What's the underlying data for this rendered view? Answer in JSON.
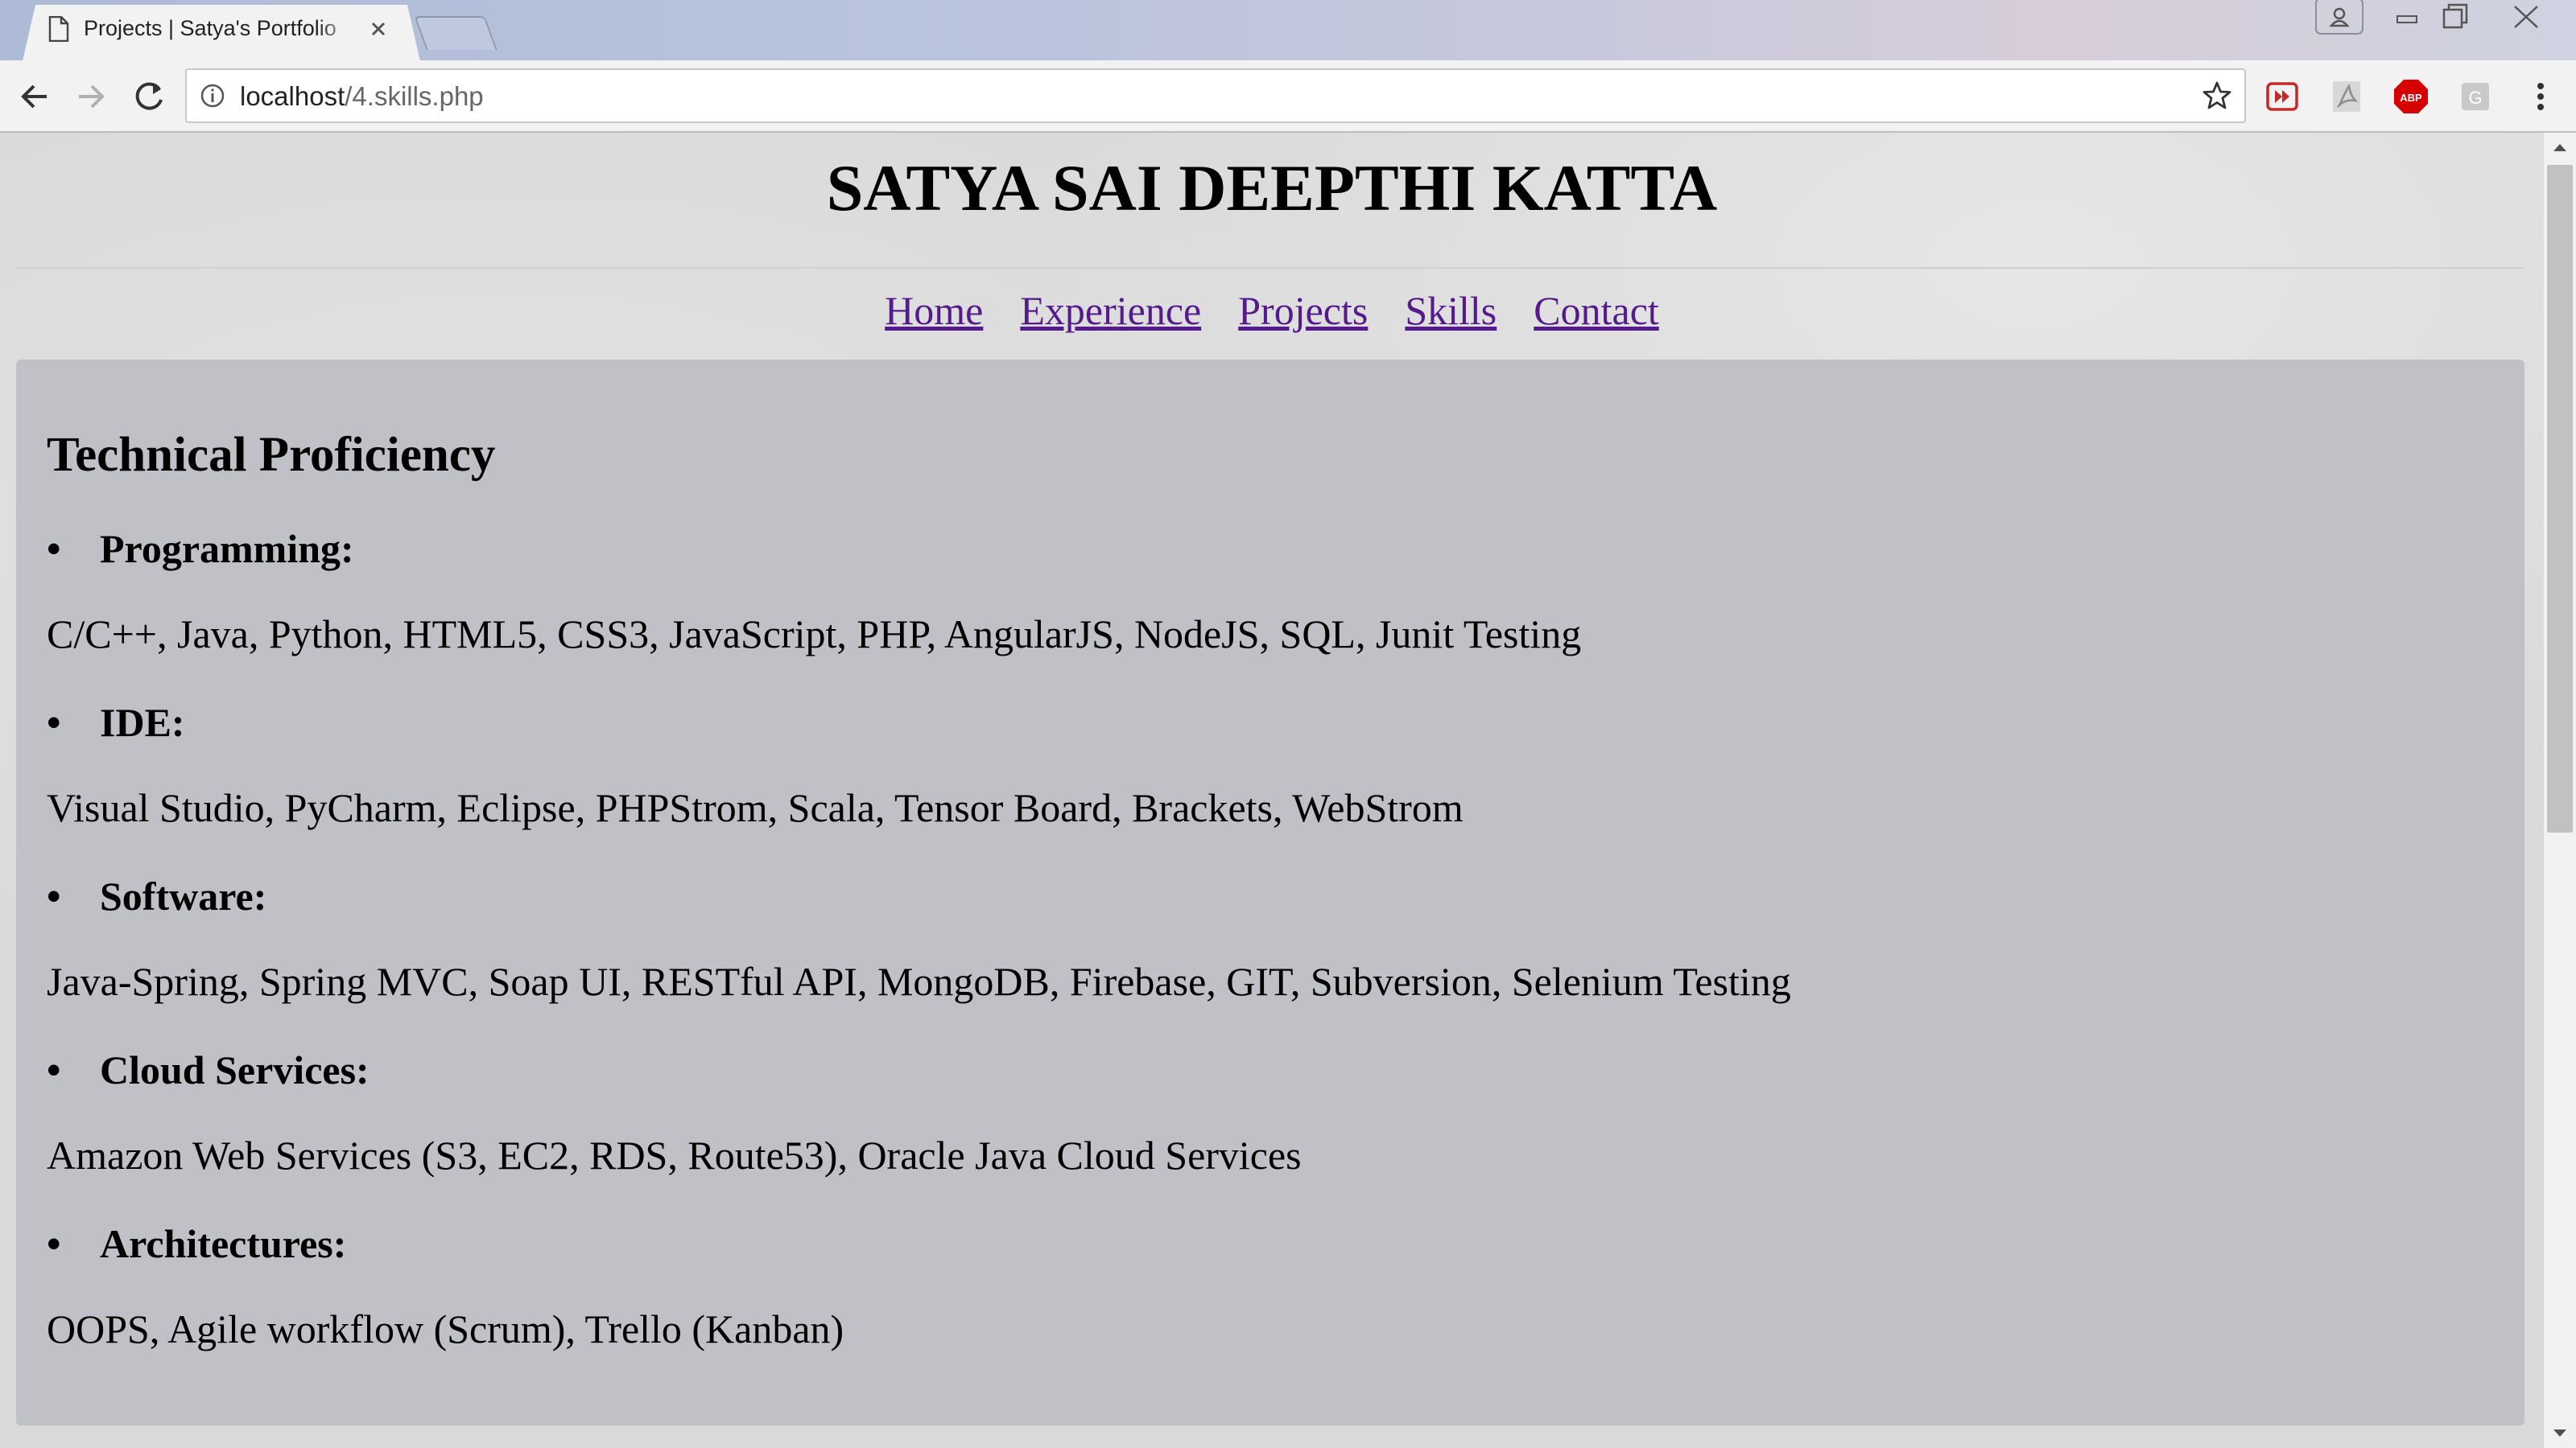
{
  "browser": {
    "tab": {
      "title": "Projects | Satya's Portfolio"
    },
    "address": {
      "host": "localhost",
      "path": "/4.skills.php"
    },
    "extensions": [
      "video-extension-icon",
      "pdf-extension-icon",
      "adblock-icon",
      "grammar-extension-icon"
    ],
    "adblock_label": "ABP",
    "ext_g_label": "G"
  },
  "page": {
    "title": "SATYA SAI DEEPTHI KATTA",
    "nav": [
      "Home",
      "Experience",
      "Projects",
      "Skills",
      "Contact"
    ],
    "section_title": "Technical Proficiency",
    "skills": [
      {
        "label": "Programming:",
        "items": "C/C++, Java, Python, HTML5, CSS3, JavaScript, PHP, AngularJS, NodeJS, SQL, Junit Testing"
      },
      {
        "label": "IDE:",
        "items": "Visual Studio, PyCharm, Eclipse, PHPStrom, Scala, Tensor Board, Brackets, WebStrom"
      },
      {
        "label": "Software:",
        "items": "Java-Spring, Spring MVC, Soap UI, RESTful API, MongoDB, Firebase, GIT, Subversion, Selenium Testing"
      },
      {
        "label": "Cloud Services:",
        "items": "Amazon Web Services (S3, EC2, RDS, Route53), Oracle Java Cloud Services"
      },
      {
        "label": "Architectures:",
        "items": "OOPS, Agile workflow (Scrum), Trello (Kanban)"
      }
    ],
    "colors": {
      "link": "#551a8b",
      "panel": "#c0c1c6"
    }
  }
}
